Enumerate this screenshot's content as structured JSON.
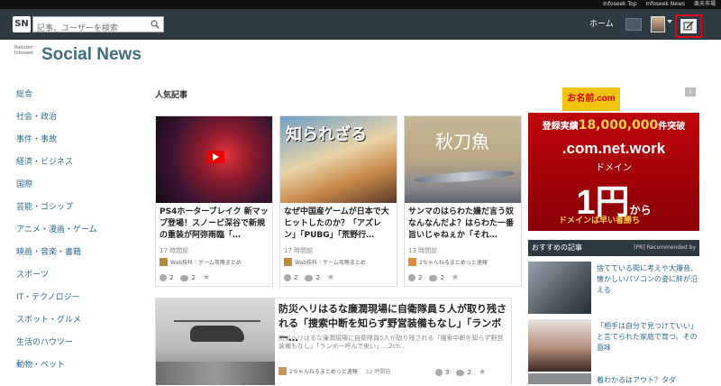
{
  "topbar": {
    "links": [
      "Infoseek Top",
      "Infoseek News",
      "楽天市場"
    ]
  },
  "nav": {
    "logo": "SN",
    "search_placeholder": "記事、ユーザーを検索",
    "home": "ホーム"
  },
  "brand": {
    "small_line1": "Rakuten",
    "small_line2": "Infoseek",
    "name": "Social News"
  },
  "categories": [
    "総合",
    "社会・政治",
    "事件・事故",
    "経済・ビジネス",
    "国際",
    "芸能・ゴシップ",
    "アニメ・漫画・ゲーム",
    "映画・音楽・書籍",
    "スポーツ",
    "IT・テクノロジー",
    "スポット・グルメ",
    "生活のハウツー",
    "動物・ペット"
  ],
  "popular": {
    "heading": "人気記事",
    "cards": [
      {
        "thumb_text": "",
        "title": "PS4ホーターブレイク 新マップ登場！スノーピ深谷で新規の重装が阿弥雨臨「…",
        "time": "17 時間前",
        "source": "Wab技科｜ゲーム攻略まとめ",
        "likes": "2",
        "comments": "2"
      },
      {
        "thumb_text": "知られざる",
        "title": "なぜ中国産ゲームが日本で大ヒットしたのか？「アズレン」「PUBG」「荒野行…",
        "time": "17 時間前",
        "source": "Wab技科｜ゲーム攻略まとめ",
        "likes": "2",
        "comments": "2"
      },
      {
        "thumb_text": "秋刀魚",
        "title": "サンマのはらわた嫌だ言う奴なんなんだよ？はらわた一番旨いじゃねぇか「それ…",
        "time": "13 時間前",
        "source": "2ちゃんねるまとめっと速報",
        "likes": "2",
        "comments": "2"
      }
    ],
    "wide": {
      "title": "防災ヘリはるな廉潤現場に自衛隊員５人が取り残される「捜索中断を知らず野営装備もなし」「ランボー…",
      "summary": "防災ヘリはるな廉潤現場に自衛隊員5人が取り残される「捜索中断を知らず野営装備もなし」「ランボー呼んで来い」…2ch…",
      "source": "2ちゃんねるまとめっと速報",
      "time": "12 時間前",
      "likes": "3",
      "comments": "2"
    }
  },
  "ad": {
    "line1_pre": "登録実績",
    "line1_num": "18,000,000",
    "line1_post": "件突破",
    "line2": ".com.net.work",
    "line3": "ドメイン",
    "line4": "1円",
    "line4_suffix": "から",
    "line5": "ドメインは早い者勝ち"
  },
  "recommend": {
    "heading": "おすすめの記事",
    "recommended_by": "[PR] Recommended by",
    "items": [
      "捨てている間に考えや大爆音、懐かしいパソコンの姿に胖が沿える",
      "「相手は自分で見つけていい」と言てられた家庭で育つ、その意味"
    ]
  },
  "partial": {
    "rec3": "着わかるはアウト？タダ"
  }
}
